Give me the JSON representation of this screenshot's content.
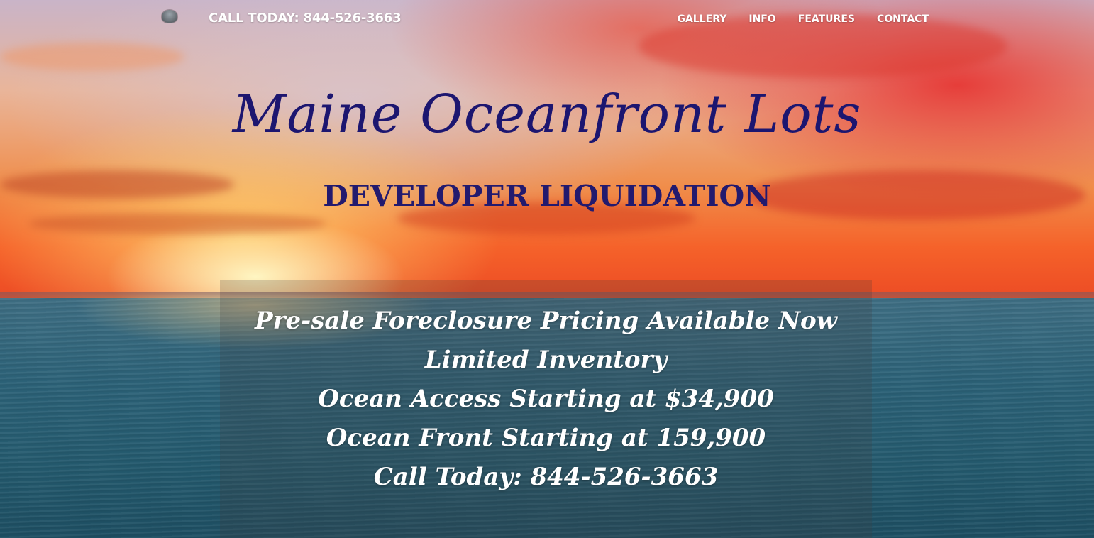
{
  "nav": {
    "phone_label": "CALL TODAY: 844-526-3663",
    "menu": [
      {
        "label": "GALLERY"
      },
      {
        "label": "INFO"
      },
      {
        "label": "FEATURES"
      },
      {
        "label": "CONTACT"
      }
    ]
  },
  "hero": {
    "title": "Maine Oceanfront Lots",
    "subtitle": "DEVELOPER LIQUIDATION",
    "lines": [
      "Pre-sale Foreclosure Pricing Available Now",
      "Limited Inventory",
      "Ocean Access Starting at $34,900",
      "Ocean Front Starting at 159,900",
      "Call Today: 844-526-3663"
    ]
  },
  "colors": {
    "title": "#1c1670",
    "subtitle": "#231a6e",
    "text_light": "#ffffff"
  },
  "icons": {
    "logo": "site-logo-icon"
  }
}
